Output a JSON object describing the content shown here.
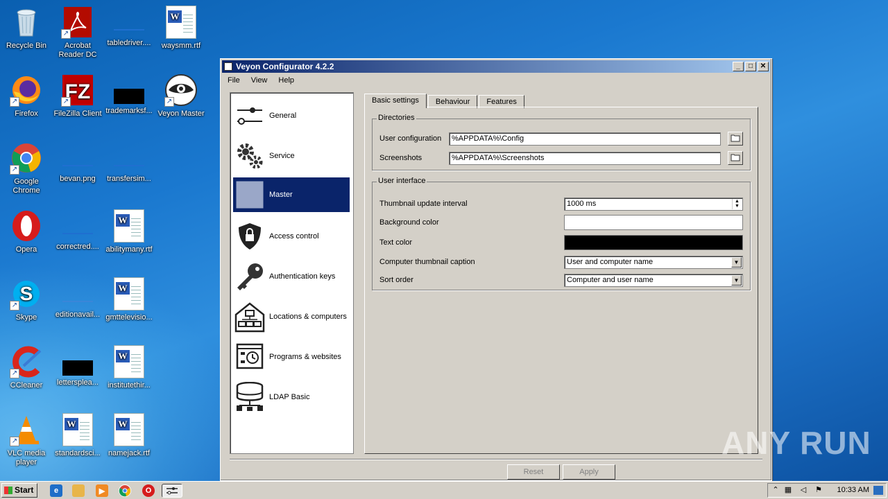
{
  "desktop": {
    "icons": [
      {
        "label": "Recycle Bin"
      },
      {
        "label": "Acrobat Reader DC"
      },
      {
        "label": "tabledriver...."
      },
      {
        "label": "waysmm.rtf"
      },
      {
        "label": "Firefox"
      },
      {
        "label": "FileZilla Client"
      },
      {
        "label": "trademarksf..."
      },
      {
        "label": "Veyon Master"
      },
      {
        "label": "Google Chrome"
      },
      {
        "label": "bevan.png"
      },
      {
        "label": "transfersim..."
      },
      {
        "label": "Opera"
      },
      {
        "label": "correctred...."
      },
      {
        "label": "abilitymany.rtf"
      },
      {
        "label": "Skype"
      },
      {
        "label": "editionavail..."
      },
      {
        "label": "gmttelevisio..."
      },
      {
        "label": "CCleaner"
      },
      {
        "label": "lettersplea..."
      },
      {
        "label": "institutethir..."
      },
      {
        "label": "VLC media player"
      },
      {
        "label": "standardsci..."
      },
      {
        "label": "namejack.rtf"
      }
    ]
  },
  "window": {
    "title": "Veyon Configurator 4.2.2",
    "menu": [
      "File",
      "View",
      "Help"
    ],
    "sidebar": [
      {
        "label": "General",
        "icon": "sliders-icon"
      },
      {
        "label": "Service",
        "icon": "gears-icon"
      },
      {
        "label": "Master",
        "icon": "master-grid-icon",
        "active": true
      },
      {
        "label": "Access control",
        "icon": "shield-lock-icon"
      },
      {
        "label": "Authentication keys",
        "icon": "key-icon"
      },
      {
        "label": "Locations & computers",
        "icon": "house-computers-icon"
      },
      {
        "label": "Programs & websites",
        "icon": "program-clock-icon"
      },
      {
        "label": "LDAP Basic",
        "icon": "database-network-icon"
      }
    ],
    "tabs": [
      "Basic settings",
      "Behaviour",
      "Features"
    ],
    "active_tab": "Basic settings",
    "directories": {
      "legend": "Directories",
      "user_config_label": "User configuration",
      "user_config_value": "%APPDATA%\\Config",
      "screenshots_label": "Screenshots",
      "screenshots_value": "%APPDATA%\\Screenshots"
    },
    "user_interface": {
      "legend": "User interface",
      "thumb_interval_label": "Thumbnail update interval",
      "thumb_interval_value": "1000 ms",
      "bg_color_label": "Background color",
      "bg_color_value": "#ffffff",
      "text_color_label": "Text color",
      "text_color_value": "#000000",
      "caption_label": "Computer thumbnail caption",
      "caption_value": "User and computer name",
      "sort_label": "Sort order",
      "sort_value": "Computer and user name"
    },
    "buttons": {
      "reset": "Reset",
      "apply": "Apply"
    }
  },
  "taskbar": {
    "start": "Start",
    "clock": "10:33 AM"
  },
  "watermark": "ANY RUN",
  "colors": {
    "selection": "#0a246a",
    "titlebar_start": "#0a246a",
    "titlebar_end": "#a6caf0",
    "face": "#d4d0c8"
  }
}
